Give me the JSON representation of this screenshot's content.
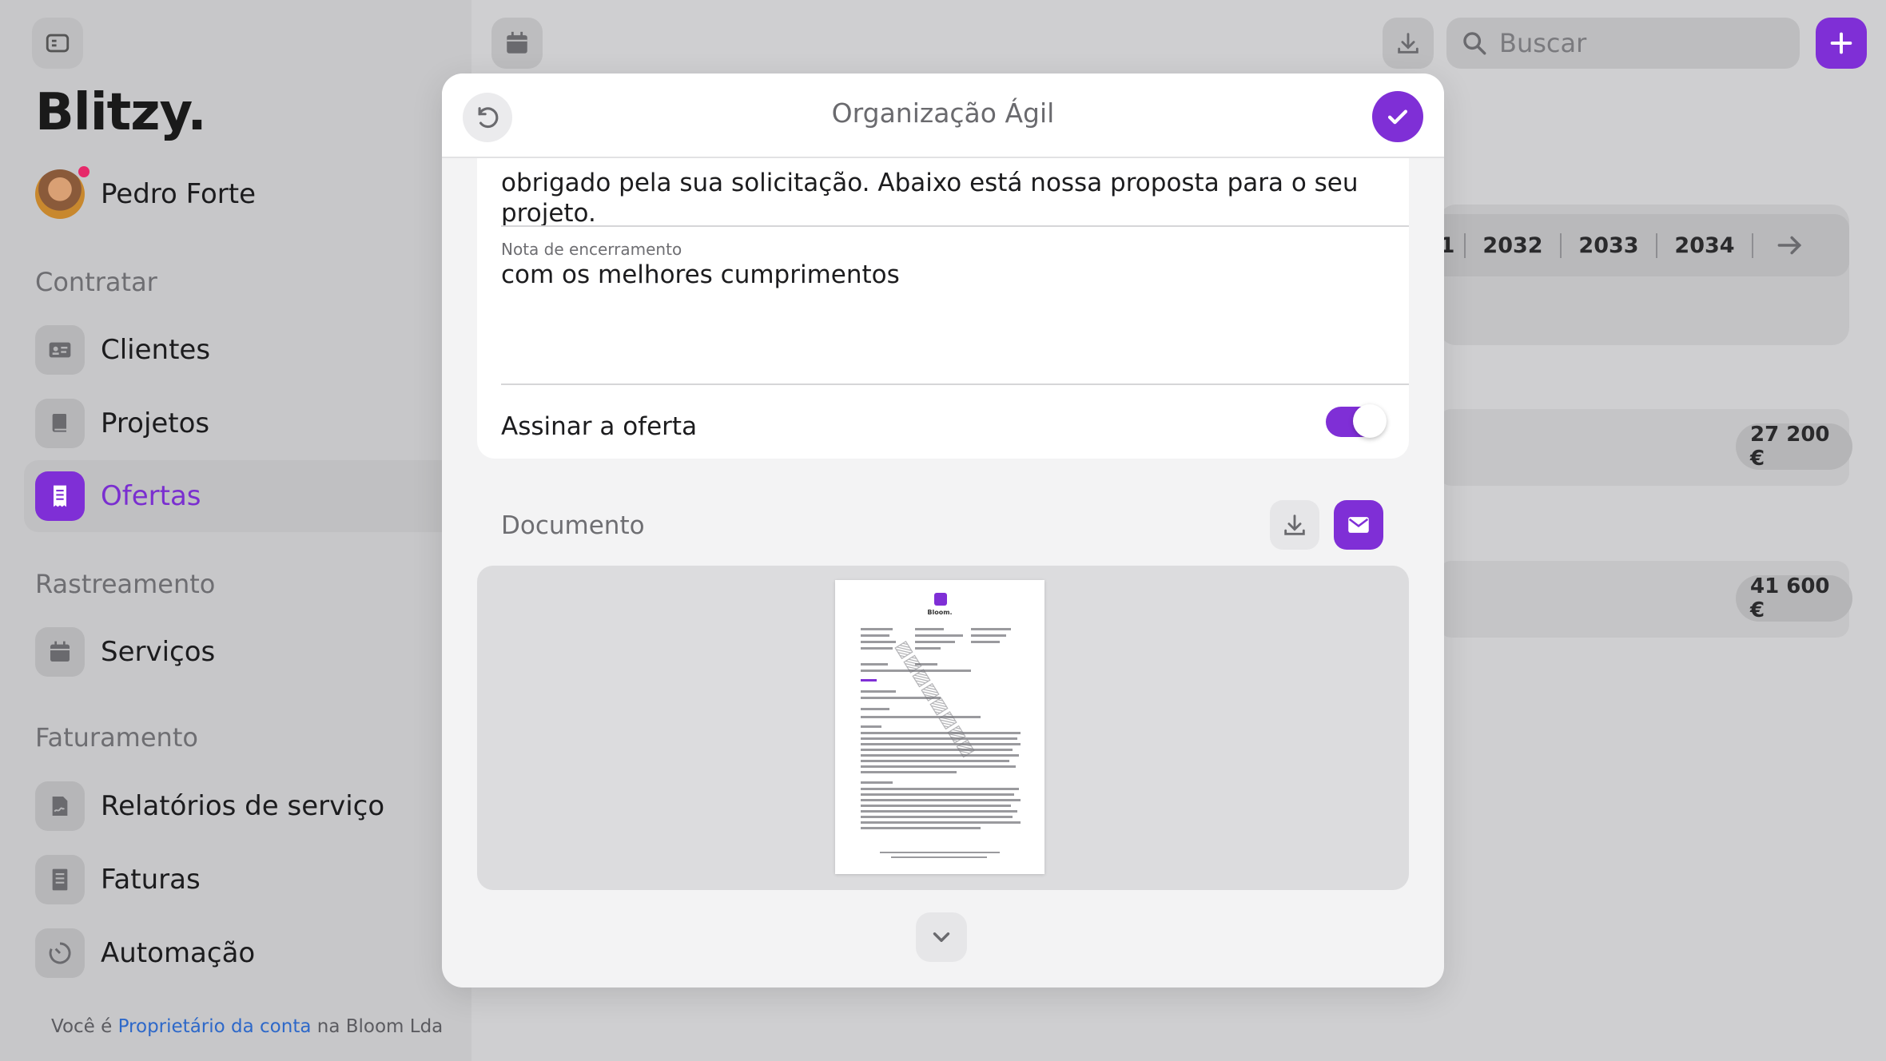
{
  "app": {
    "logo": "Blitzy.",
    "user_name": "Pedro Forte"
  },
  "sidebar": {
    "sections": [
      {
        "title": "Contratar",
        "items": [
          {
            "label": "Clientes",
            "icon": "contact-card-icon"
          },
          {
            "label": "Projetos",
            "icon": "book-icon"
          },
          {
            "label": "Ofertas",
            "icon": "receipt-icon",
            "active": true
          }
        ]
      },
      {
        "title": "Rastreamento",
        "items": [
          {
            "label": "Serviços",
            "icon": "calendar-icon"
          }
        ]
      },
      {
        "title": "Faturamento",
        "items": [
          {
            "label": "Relatórios de serviço",
            "icon": "signature-icon"
          },
          {
            "label": "Faturas",
            "icon": "invoice-icon"
          },
          {
            "label": "Automação",
            "icon": "timer-icon"
          }
        ]
      }
    ],
    "footer": {
      "prefix": "Você é",
      "role_link": "Proprietário da conta",
      "suffix": "na Bloom Lda"
    }
  },
  "toolbar": {
    "search_placeholder": "Buscar"
  },
  "background": {
    "years": [
      "1",
      "2032",
      "2033",
      "2034"
    ],
    "amounts": [
      "27 200 €",
      "41 600 €"
    ]
  },
  "modal": {
    "title": "Organização Ágil",
    "intro_text": "obrigado pela sua solicitação. Abaixo está nossa proposta para o seu projeto.",
    "closing_label": "Nota de encerramento",
    "closing_value": "com os melhores cumprimentos",
    "sign_label": "Assinar a oferta",
    "sign_enabled": true,
    "document_label": "Documento",
    "thumbnail_brand": "Bloom.",
    "accent_color": "#7f2fd6"
  }
}
